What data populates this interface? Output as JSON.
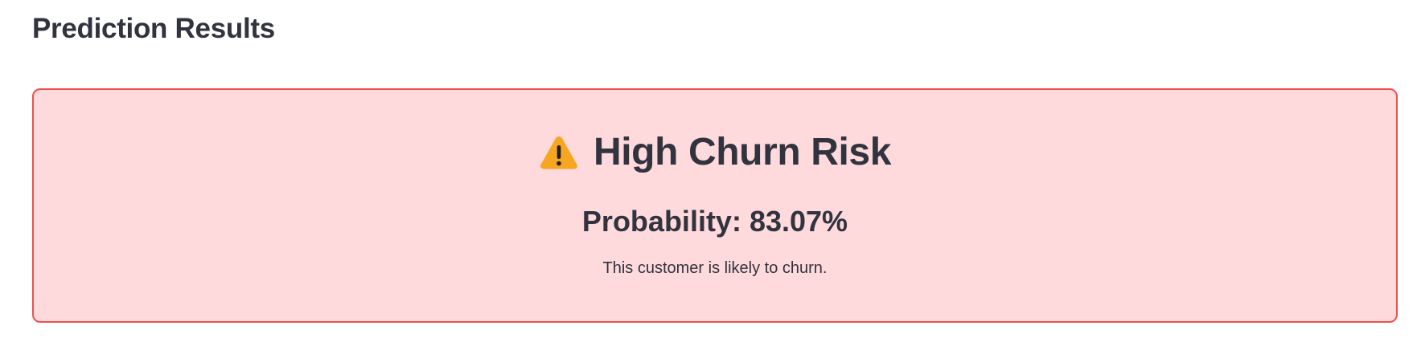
{
  "section": {
    "title": "Prediction Results"
  },
  "result": {
    "icon": "warning-icon",
    "heading": "High Churn Risk",
    "probability_label": "Probability: ",
    "probability_value": "83.07%",
    "probability": 0.8307,
    "message": "This customer is likely to churn."
  },
  "colors": {
    "card_background": "#ffdadc",
    "card_border": "#f04f4f",
    "text": "#31333f",
    "warning_icon": "#f6a623"
  }
}
